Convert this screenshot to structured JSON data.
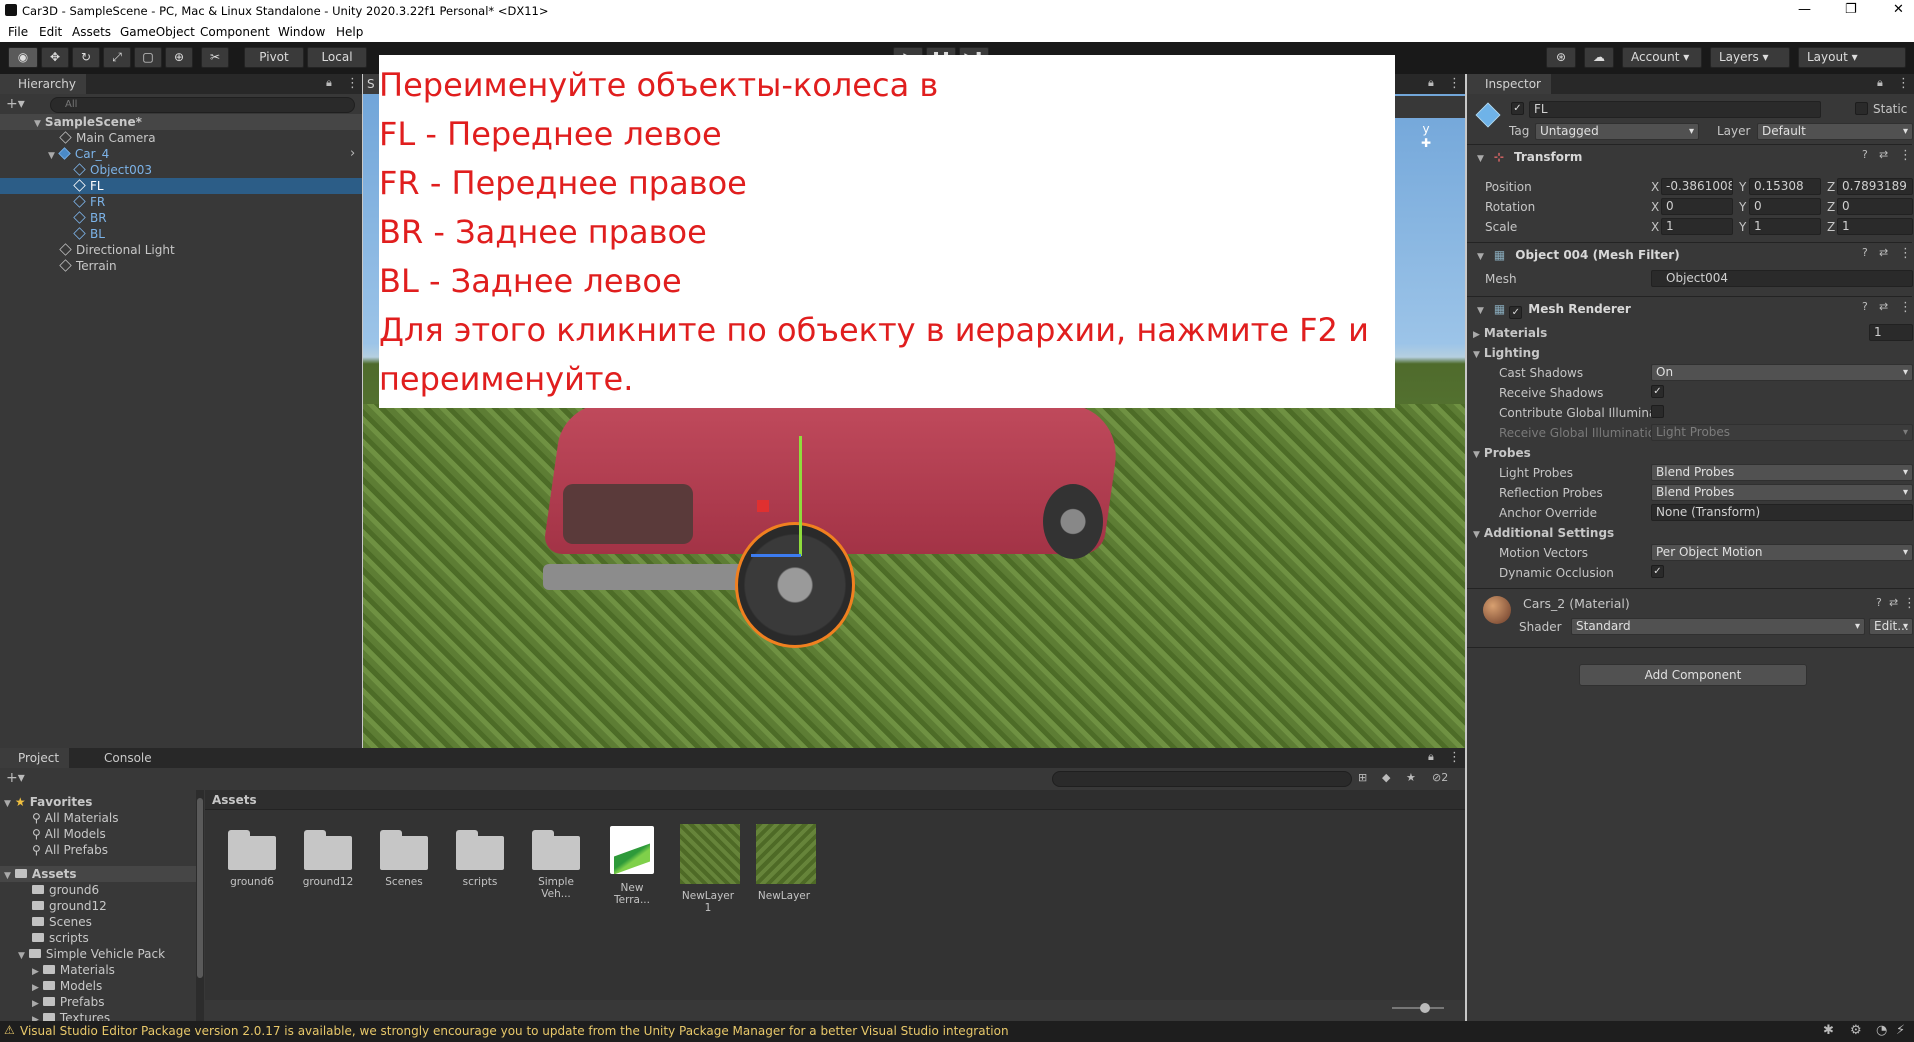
{
  "window": {
    "title": "Car3D - SampleScene - PC, Mac & Linux Standalone - Unity 2020.3.22f1 Personal* <DX11>"
  },
  "menu": [
    "File",
    "Edit",
    "Assets",
    "GameObject",
    "Component",
    "Window",
    "Help"
  ],
  "toolbar": {
    "pivot": "Pivot",
    "local": "Local",
    "account": "Account",
    "layers": "Layers",
    "layout": "Layout"
  },
  "hierarchy": {
    "tab": "Hierarchy",
    "search_placeholder": "All",
    "scene": "SampleScene*",
    "items": [
      {
        "label": "Main Camera"
      },
      {
        "label": "Car_4"
      },
      {
        "label": "Object003"
      },
      {
        "label": "FL"
      },
      {
        "label": "FR"
      },
      {
        "label": "BR"
      },
      {
        "label": "BL"
      },
      {
        "label": "Directional Light"
      },
      {
        "label": "Terrain"
      }
    ]
  },
  "scene_tab": "S",
  "instruction": {
    "lines": [
      "Переименуйте объекты-колеса в",
      "FL - Переднее левое",
      "FR - Переднее правое",
      "BR - Заднее правое",
      "BL - Заднее левое",
      "Для этого кликните по объекту в иерархии, нажмите F2 и",
      "переименуйте."
    ]
  },
  "inspector": {
    "tab": "Inspector",
    "object_name": "FL",
    "static_label": "Static",
    "tag_label": "Tag",
    "tag_value": "Untagged",
    "layer_label": "Layer",
    "layer_value": "Default",
    "transform": {
      "title": "Transform",
      "position": {
        "label": "Position",
        "x": "-0.3861008",
        "y": "0.15308",
        "z": "0.7893189"
      },
      "rotation": {
        "label": "Rotation",
        "x": "0",
        "y": "0",
        "z": "0"
      },
      "scale": {
        "label": "Scale",
        "x": "1",
        "y": "1",
        "z": "1"
      },
      "axis_x": "X",
      "axis_y": "Y",
      "axis_z": "Z"
    },
    "mesh_filter": {
      "title": "Object 004 (Mesh Filter)",
      "mesh_label": "Mesh",
      "mesh_value": "Object004"
    },
    "mesh_renderer": {
      "title": "Mesh Renderer",
      "materials_label": "Materials",
      "materials_count": "1",
      "lighting_label": "Lighting",
      "cast_shadows_label": "Cast Shadows",
      "cast_shadows_value": "On",
      "receive_shadows_label": "Receive Shadows",
      "contribute_gi_label": "Contribute Global Illuminat",
      "receive_gi_label": "Receive Global Illumination",
      "receive_gi_value": "Light Probes",
      "probes_label": "Probes",
      "light_probes_label": "Light Probes",
      "light_probes_value": "Blend Probes",
      "reflection_probes_label": "Reflection Probes",
      "reflection_probes_value": "Blend Probes",
      "anchor_override_label": "Anchor Override",
      "anchor_override_value": "None (Transform)",
      "additional_label": "Additional Settings",
      "motion_vectors_label": "Motion Vectors",
      "motion_vectors_value": "Per Object Motion",
      "dynamic_occlusion_label": "Dynamic Occlusion"
    },
    "material": {
      "title": "Cars_2 (Material)",
      "shader_label": "Shader",
      "shader_value": "Standard",
      "edit_label": "Edit..."
    },
    "add_component": "Add Component"
  },
  "project": {
    "tabs": [
      "Project",
      "Console"
    ],
    "hidden_count": "2",
    "favorites_label": "Favorites",
    "favorites": [
      "All Materials",
      "All Models",
      "All Prefabs"
    ],
    "assets_label": "Assets",
    "tree": [
      "ground6",
      "ground12",
      "Scenes",
      "scripts",
      "Simple Vehicle Pack",
      "Materials",
      "Models",
      "Prefabs",
      "Textures"
    ],
    "breadcrumb": "Assets",
    "grid": [
      {
        "label": "ground6",
        "kind": "folder"
      },
      {
        "label": "ground12",
        "kind": "folder"
      },
      {
        "label": "Scenes",
        "kind": "folder"
      },
      {
        "label": "scripts",
        "kind": "folder"
      },
      {
        "label": "Simple Veh...",
        "kind": "folder"
      },
      {
        "label": "New Terra...",
        "kind": "terrain"
      },
      {
        "label": "NewLayer 1",
        "kind": "texture"
      },
      {
        "label": "NewLayer",
        "kind": "texture"
      }
    ]
  },
  "status": {
    "message": "Visual Studio Editor Package version 2.0.17 is available, we strongly encourage you to update from the Unity Package Manager for a better Visual Studio integration"
  },
  "colors": {
    "accent": "#2c5d87",
    "warning": "#e8c86a",
    "overlay_text": "#e01e1e"
  }
}
